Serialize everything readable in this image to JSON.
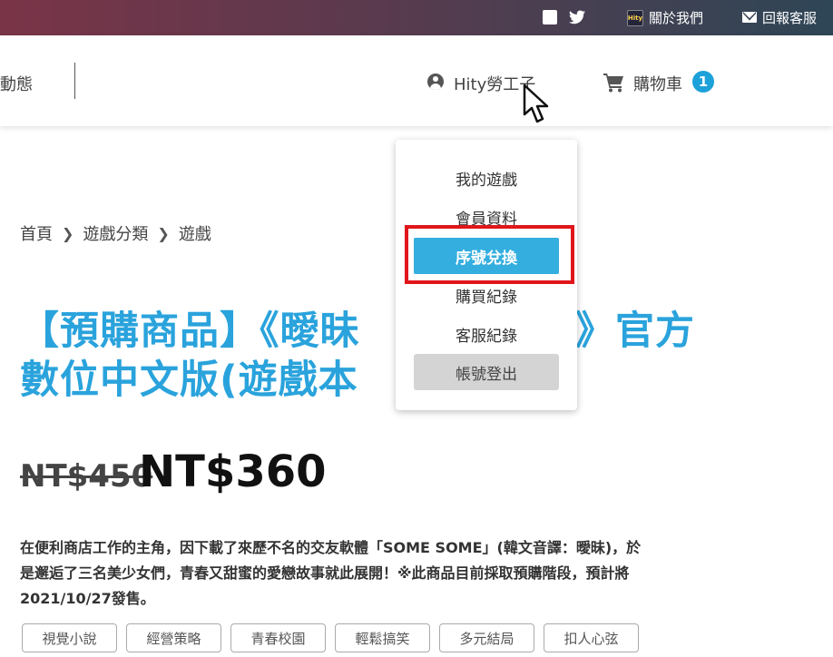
{
  "topbar": {
    "about_label": "關於我們",
    "support_label": "回報客服",
    "logo_text": "Hity"
  },
  "header": {
    "nav_item": "動態",
    "user_name": "Hity勞工子",
    "cart_label": "購物車",
    "cart_count": "1"
  },
  "dropdown": {
    "items": [
      "我的遊戲",
      "會員資料",
      "序號兌換",
      "購買紀錄",
      "客服紀錄",
      "帳號登出"
    ],
    "active_index": 2,
    "highlight_color": "#e0161b",
    "active_color": "#34aedf"
  },
  "breadcrumb": {
    "items": [
      "首頁",
      "遊戲分類",
      "遊戲"
    ]
  },
  "product": {
    "title_line1": "【預購商品】《曖昧",
    "title_line1_tail": "》官方",
    "title_line2": "數位中文版(遊戲本",
    "price_old": "NT$450",
    "price_new": "NT$360",
    "description": "在便利商店工作的主角，因下載了來歷不名的交友軟體「SOME SOME」(韓文音譯：曖昧)，於是邂逅了三名美少女們，青春又甜蜜的愛戀故事就此展開！※此商品目前採取預購階段，預計將2021/10/27發售。",
    "tags": [
      "視覺小說",
      "經營策略",
      "青春校園",
      "輕鬆搞笑",
      "多元結局",
      "扣人心弦"
    ]
  },
  "colors": {
    "accent": "#2aa3dc",
    "badge": "#1da1d9"
  }
}
